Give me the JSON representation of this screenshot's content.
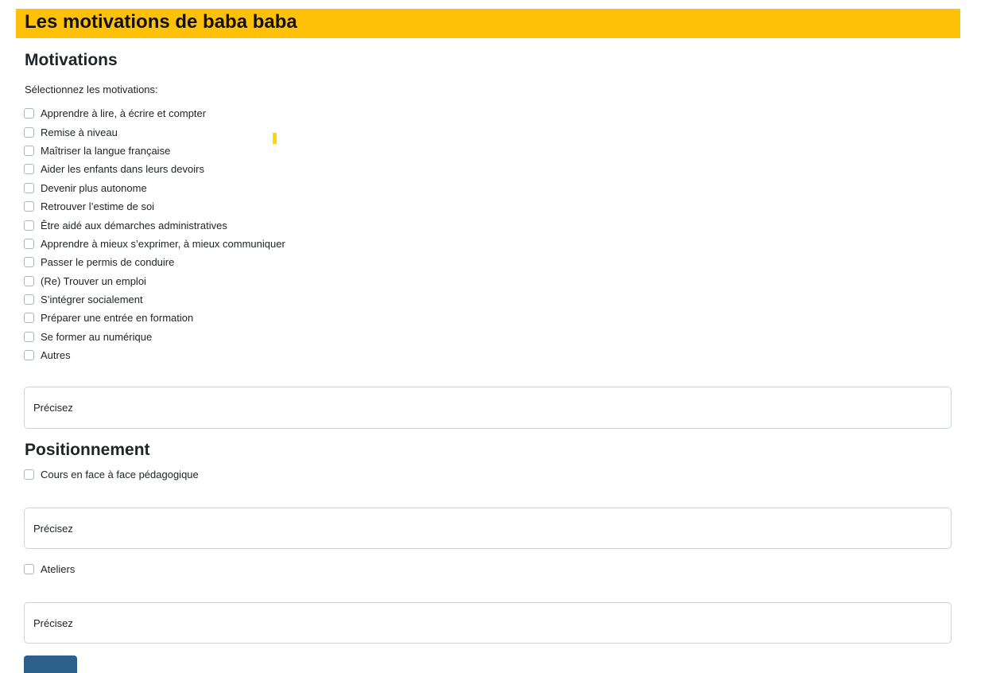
{
  "header": {
    "title": "Les motivations de baba baba"
  },
  "motivations": {
    "title": "Motivations",
    "intro": "Sélectionnez les motivations:",
    "items": [
      {
        "label": "Apprendre à lire, à écrire et compter",
        "checked": false
      },
      {
        "label": "Remise à niveau",
        "checked": false
      },
      {
        "label": "Maîtriser la langue française",
        "checked": false
      },
      {
        "label": "Aider les enfants dans leurs devoirs",
        "checked": false
      },
      {
        "label": "Devenir plus autonome",
        "checked": false
      },
      {
        "label": "Retrouver l’estime de soi",
        "checked": false
      },
      {
        "label": "Être aidé aux démarches administratives",
        "checked": false
      },
      {
        "label": "Apprendre à mieux s’exprimer, à mieux communiquer",
        "checked": false
      },
      {
        "label": "Passer le permis de conduire",
        "checked": false
      },
      {
        "label": "(Re) Trouver un emploi",
        "checked": false
      },
      {
        "label": "S’intégrer socialement",
        "checked": false
      },
      {
        "label": "Préparer une entrée en formation",
        "checked": false
      },
      {
        "label": "Se former au numérique",
        "checked": false
      },
      {
        "label": "Autres",
        "checked": false
      }
    ],
    "other_field": {
      "placeholder": "Précisez",
      "value": ""
    }
  },
  "positionnement": {
    "title": "Positionnement",
    "face_to_face": {
      "label": "Cours en face à face pédagogique",
      "checked": false
    },
    "face_to_face_field": {
      "placeholder": "Précisez",
      "value": ""
    },
    "ateliers": {
      "label": "Ateliers",
      "checked": false
    },
    "ateliers_field": {
      "placeholder": "Précisez",
      "value": ""
    }
  },
  "colors": {
    "header_bg": "#ffc107",
    "button_bg": "#2c5f8a",
    "cursor_mark": "#ffd600"
  }
}
